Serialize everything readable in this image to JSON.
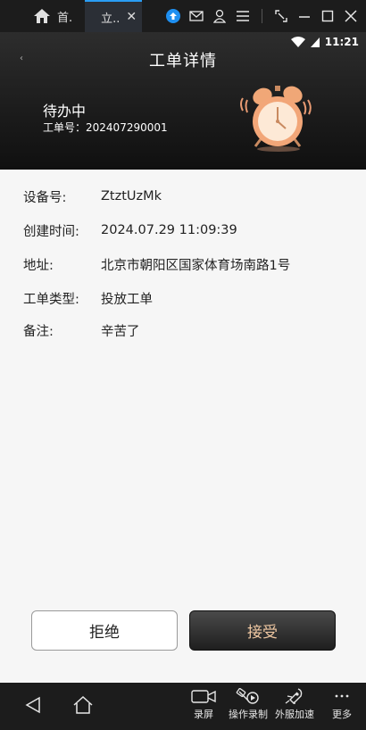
{
  "chrome": {
    "home_tab_label": "首.",
    "active_tab_label": "立.."
  },
  "status_bar": {
    "time": "11:21"
  },
  "header": {
    "back_glyph": "‹",
    "title": "工单详情",
    "status": "待办中",
    "order_no_label": "工单号：",
    "order_no": "202407290001"
  },
  "details": [
    {
      "label": "设备号:",
      "value": "ZtztUzMk"
    },
    {
      "label": "创建时间:",
      "value": "2024.07.29 11:09:39"
    },
    {
      "label": "地址:",
      "value": "北京市朝阳区国家体育场南路1号"
    },
    {
      "label": "工单类型:",
      "value": "投放工单"
    },
    {
      "label": "备注:",
      "value": "辛苦了"
    }
  ],
  "actions": {
    "reject": "拒绝",
    "accept": "接受"
  },
  "toolbar": {
    "record_label": "录屏",
    "macro_label": "操作录制",
    "accelerate_label": "外服加速",
    "more_label": "更多"
  },
  "colors": {
    "accept_text": "#f1c9a3",
    "active_tab_accent": "#2a9df4",
    "upload_icon": "#1e8ff0"
  }
}
